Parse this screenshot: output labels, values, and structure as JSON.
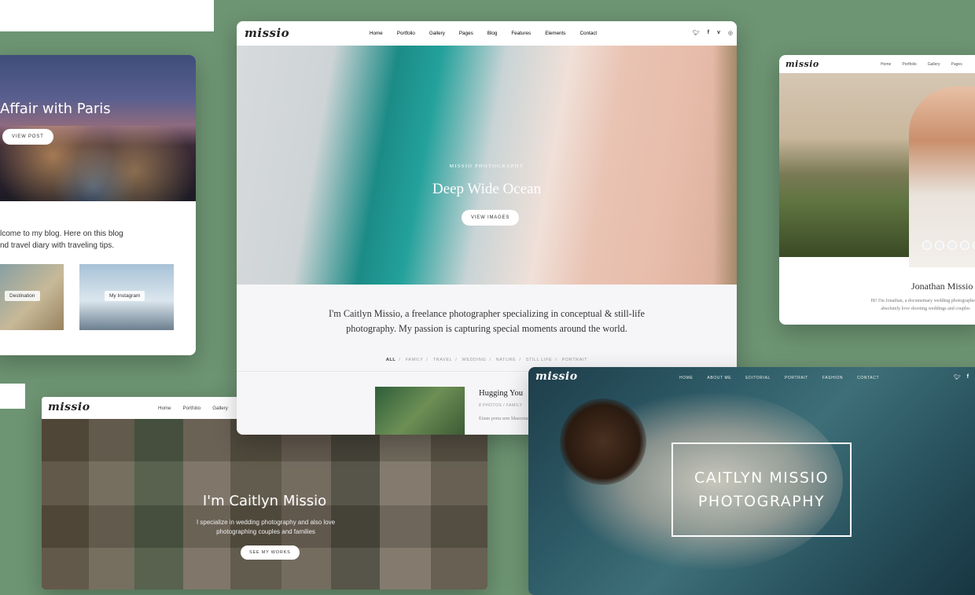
{
  "paris": {
    "title": "Affair with Paris",
    "button": "VIEW POST",
    "intro_line1": "lcome to my blog. Here on this blog",
    "intro_line2": "nd travel diary with traveling tips.",
    "tags": [
      "Destination",
      "My Instagram"
    ]
  },
  "center": {
    "logo": "missio",
    "nav": [
      "Home",
      "Portfolio",
      "Gallery",
      "Pages",
      "Blog",
      "Features",
      "Elements",
      "Contact"
    ],
    "social": [
      "twitter-icon",
      "facebook-icon",
      "vimeo-icon",
      "instagram-icon"
    ],
    "kicker": "MISSIO PHOTOGRAPHY",
    "title": "Deep Wide Ocean",
    "button": "VIEW IMAGES",
    "intro": "I'm Caitlyn Missio, a freelance photographer specializing in conceptual & still-life photography. My passion is capturing special moments around the world.",
    "filters": [
      "ALL",
      "FAMILY",
      "TRAVEL",
      "WEDDING",
      "NATURE",
      "STILL LIFE",
      "PORTRAIT"
    ],
    "post": {
      "title": "Hugging You",
      "meta": "8 PHOTOS  /  FAMILY",
      "text": "Etiam porta sem Maecenas faucibus"
    }
  },
  "right": {
    "logo": "missio",
    "nav": [
      "Home",
      "Portfolio",
      "Gallery",
      "Pages"
    ],
    "name": "Jonathan Missio",
    "bio": "Hi! I'm Jonathan, a documentary wedding photographer. I absolutely love shooting weddings and couples"
  },
  "bottom_left": {
    "logo": "missio",
    "nav": [
      "Home",
      "Portfolio",
      "Gallery"
    ],
    "title": "I'm Caitlyn Missio",
    "subtitle": "I specialize in wedding photography and also love photographing couples and families",
    "button": "SEE MY WORKS"
  },
  "bottom_right": {
    "logo": "missio",
    "nav": [
      "HOME",
      "ABOUT ME",
      "EDITORIAL",
      "PORTRAIT",
      "FASHION",
      "CONTACT"
    ],
    "social": [
      "twitter-icon",
      "facebook-icon"
    ],
    "title_line1": "CAITLYN MISSIO",
    "title_line2": "PHOTOGRAPHY"
  },
  "colors": {
    "background": "#6d9473",
    "card": "#ffffff",
    "text_dark": "#222222"
  }
}
